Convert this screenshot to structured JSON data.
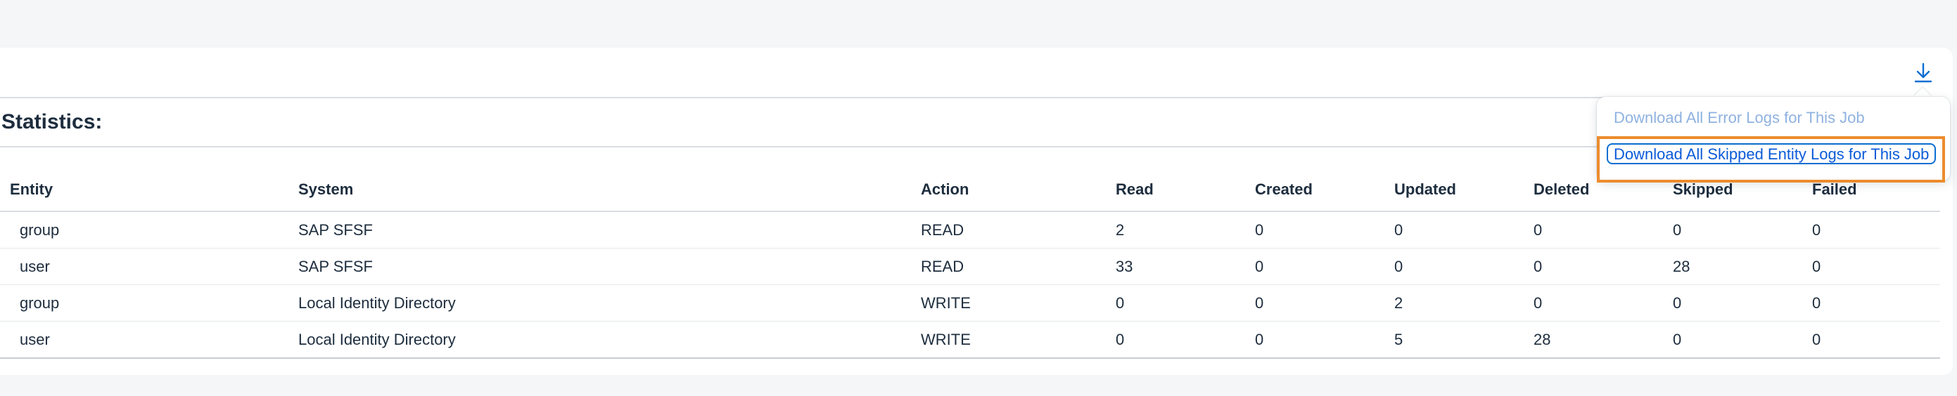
{
  "statistics": {
    "title": "Statistics:",
    "columns": [
      "Entity",
      "System",
      "Action",
      "Read",
      "Created",
      "Updated",
      "Deleted",
      "Skipped",
      "Failed"
    ],
    "rows": [
      [
        "group",
        "SAP SFSF",
        "READ",
        "2",
        "0",
        "0",
        "0",
        "0",
        "0"
      ],
      [
        "user",
        "SAP SFSF",
        "READ",
        "33",
        "0",
        "0",
        "0",
        "28",
        "0"
      ],
      [
        "group",
        "Local Identity Directory",
        "WRITE",
        "0",
        "0",
        "2",
        "0",
        "0",
        "0"
      ],
      [
        "user",
        "Local Identity Directory",
        "WRITE",
        "0",
        "0",
        "5",
        "28",
        "0",
        "0"
      ]
    ]
  },
  "toolbar": {
    "download_icon": "download-icon"
  },
  "download_menu": {
    "items": [
      {
        "label": "Download All Error Logs for This Job",
        "state": "disabled"
      },
      {
        "label": "Download All Skipped Entity Logs for This Job",
        "state": "focused"
      }
    ]
  },
  "colors": {
    "accent": "#0a6ed1",
    "disabled_link": "#8fb2e0",
    "highlight": "#ec8c2d"
  }
}
